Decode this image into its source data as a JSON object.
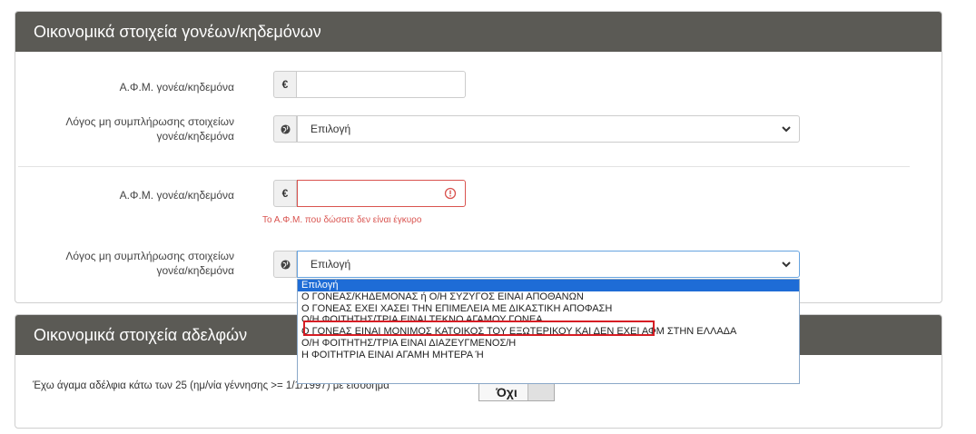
{
  "parents_section": {
    "title": "Οικονομικά στοιχεία γονέων/κηδεμόνων",
    "guardian1": {
      "afm_label": "Α.Φ.Μ. γονέα/κηδεμόνα",
      "afm_addon": "€",
      "afm_value": "",
      "reason_label_line1": "Λόγος μη συμπλήρωσης στοιχείων",
      "reason_label_line2": "γονέα/κηδεμόνα",
      "reason_value": "Επιλογή"
    },
    "guardian2": {
      "afm_label": "Α.Φ.Μ. γονέα/κηδεμόνα",
      "afm_addon": "€",
      "afm_value": "",
      "afm_error": "Το Α.Φ.Μ. που δώσατε δεν είναι έγκυρο",
      "reason_label_line1": "Λόγος μη συμπλήρωσης στοιχείων",
      "reason_label_line2": "γονέα/κηδεμόνα",
      "reason_value": "Επιλογή"
    }
  },
  "dropdown_options": [
    "Επιλογή",
    "Ο ΓΟΝΕΑΣ/ΚΗΔΕΜΟΝΑΣ ή Ο/Η ΣΥΖΥΓΟΣ ΕΙΝΑΙ ΑΠΟΘΑΝΩΝ",
    "Ο ΓΟΝΕΑΣ ΕΧΕΙ ΧΑΣΕΙ ΤΗΝ ΕΠΙΜΕΛΕΙΑ ΜΕ ΔΙΚΑΣΤΙΚΗ ΑΠΟΦΑΣΗ",
    "Ο/Η ΦΟΙΤΗΤΗΣ/ΤΡΙΑ ΕΙΝΑΙ ΤΕΚΝΟ ΑΓΑΜΟΥ ΓΟΝΕΑ",
    "Ο ΓΟΝΕΑΣ ΕΙΝΑΙ ΜΟΝΙΜΟΣ ΚΑΤΟΙΚΟΣ ΤΟΥ ΕΞΩΤΕΡΙΚΟΥ ΚΑΙ ΔΕΝ ΕΧΕΙ ΑΦΜ ΣΤΗΝ ΕΛΛΑΔΑ",
    "Ο/Η ΦΟΙΤΗΤΗΣ/ΤΡΙΑ ΕΙΝΑΙ ΔΙΑΖΕΥΓΜΕΝΟΣ/Η",
    "Η ΦΟΙΤΗΤΡΙΑ ΕΙΝΑΙ ΑΓΑΜΗ ΜΗΤΕΡΑ Ή"
  ],
  "siblings_section": {
    "title": "Οικονομικά στοιχεία αδελφών",
    "question": "Έχω άγαμα αδέλφια κάτω των 25 (ημ/νία γέννησης >= 1/1/1997) με εισόδημα",
    "toggle_value": "Όχι"
  },
  "colors": {
    "header_bg": "#5b5a55",
    "error": "#d9534f",
    "selected_option": "#1e6cd6",
    "highlight_box": "#d61d24"
  }
}
